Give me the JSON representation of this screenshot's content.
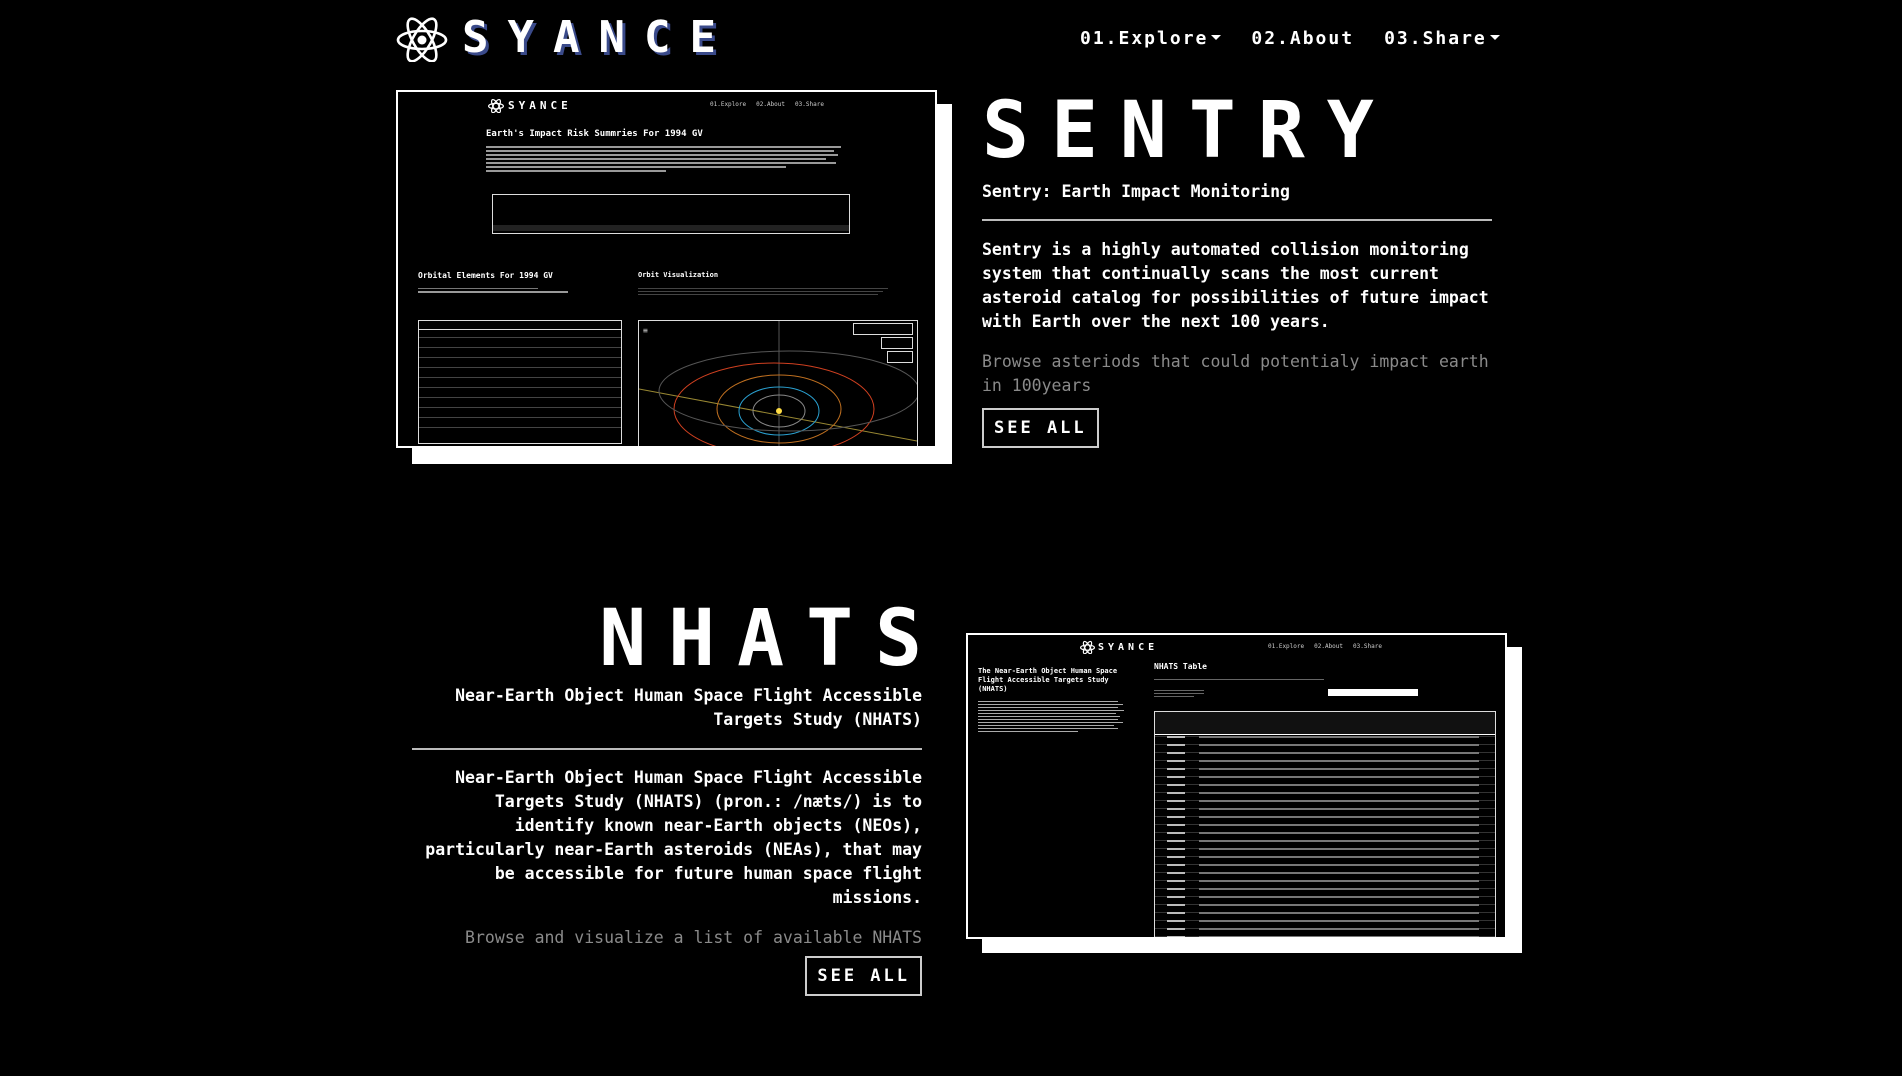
{
  "brand": {
    "name": "SYANCE"
  },
  "nav": {
    "items": [
      {
        "label": "01.Explore",
        "dropdown": true
      },
      {
        "label": "02.About",
        "dropdown": false
      },
      {
        "label": "03.Share",
        "dropdown": true
      }
    ]
  },
  "sentry": {
    "title": "SENTRY",
    "subtitle": "Sentry: Earth Impact Monitoring",
    "description": "Sentry is a highly automated collision monitoring system that continually scans the most current asteroid catalog for possibilities of future impact with Earth over the next 100 years.",
    "browse_text": "Browse asteriods that could potentialy impact earth in 100years",
    "button_label": "SEE ALL",
    "screenshot": {
      "heading": "Earth's Impact Risk Summries For 1994 GV",
      "orbital_heading": "Orbital Elements For 1994 GV",
      "orbit_heading": "Orbit Visualization"
    }
  },
  "nhats": {
    "title": "NHATS",
    "subtitle": "Near-Earth Object Human Space Flight Accessible Targets Study (NHATS)",
    "description": "Near-Earth Object Human Space Flight Accessible Targets Study (NHATS) (pron.: /næts/) is to identify known near-Earth objects (NEOs), particularly near-Earth asteroids (NEAs), that may be accessible for future human space flight missions.",
    "browse_text": "Browse and visualize a list of available NHATS",
    "button_label": "SEE ALL",
    "screenshot": {
      "side_heading": "The Near-Earth Object Human Space Flight Accessible Targets Study (NHATS)",
      "table_heading": "NHATS Table"
    }
  }
}
